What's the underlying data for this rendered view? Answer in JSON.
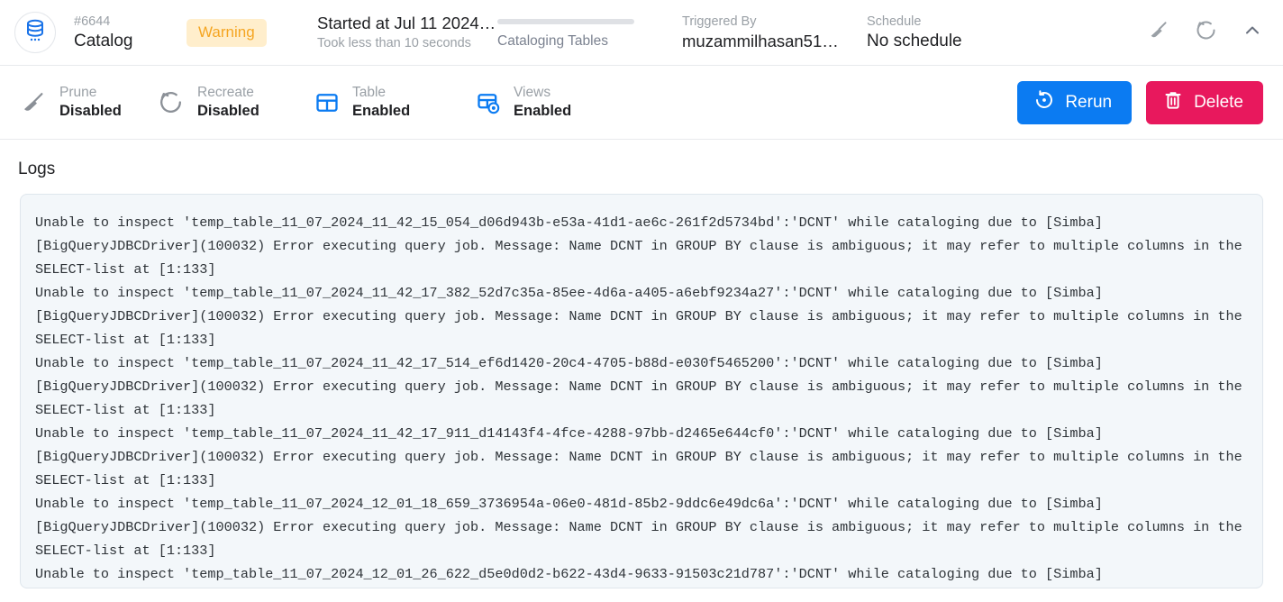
{
  "header": {
    "avatar_icon": "database-icon",
    "run_number_label": "#6644",
    "run_name": "Catalog",
    "status_badge": "Warning",
    "status_badge_color": "#f5a623",
    "started_title": "Started at Jul 11 2024, …",
    "started_subtitle": "Took less than 10 seconds",
    "progress_label": "Cataloging Tables",
    "triggered_by_label": "Triggered By",
    "triggered_by_value": "muzammilhasan515…",
    "schedule_label": "Schedule",
    "schedule_value": "No schedule",
    "icons": [
      "broom-icon",
      "recreate-icon",
      "chevron-up-icon"
    ]
  },
  "actionbar": {
    "items": [
      {
        "icon": "broom-icon",
        "name": "Prune",
        "value": "Disabled",
        "enabled": false
      },
      {
        "icon": "recreate-icon",
        "name": "Recreate",
        "value": "Disabled",
        "enabled": false
      },
      {
        "icon": "table-icon",
        "name": "Table",
        "value": "Enabled",
        "enabled": true
      },
      {
        "icon": "views-icon",
        "name": "Views",
        "value": "Enabled",
        "enabled": true
      }
    ],
    "rerun_label": "Rerun",
    "rerun_icon": "rerun-icon",
    "rerun_color": "#0b7bf2",
    "delete_label": "Delete",
    "delete_icon": "trash-icon",
    "delete_color": "#e8185d"
  },
  "logs": {
    "title": "Logs",
    "content": "Unable to inspect 'temp_table_11_07_2024_11_42_15_054_d06d943b-e53a-41d1-ae6c-261f2d5734bd':'DCNT' while cataloging due to [Simba][BigQueryJDBCDriver](100032) Error executing query job. Message: Name DCNT in GROUP BY clause is ambiguous; it may refer to multiple columns in the SELECT-list at [1:133]\nUnable to inspect 'temp_table_11_07_2024_11_42_17_382_52d7c35a-85ee-4d6a-a405-a6ebf9234a27':'DCNT' while cataloging due to [Simba][BigQueryJDBCDriver](100032) Error executing query job. Message: Name DCNT in GROUP BY clause is ambiguous; it may refer to multiple columns in the SELECT-list at [1:133]\nUnable to inspect 'temp_table_11_07_2024_11_42_17_514_ef6d1420-20c4-4705-b88d-e030f5465200':'DCNT' while cataloging due to [Simba][BigQueryJDBCDriver](100032) Error executing query job. Message: Name DCNT in GROUP BY clause is ambiguous; it may refer to multiple columns in the SELECT-list at [1:133]\nUnable to inspect 'temp_table_11_07_2024_11_42_17_911_d14143f4-4fce-4288-97bb-d2465e644cf0':'DCNT' while cataloging due to [Simba][BigQueryJDBCDriver](100032) Error executing query job. Message: Name DCNT in GROUP BY clause is ambiguous; it may refer to multiple columns in the SELECT-list at [1:133]\nUnable to inspect 'temp_table_11_07_2024_12_01_18_659_3736954a-06e0-481d-85b2-9ddc6e49dc6a':'DCNT' while cataloging due to [Simba][BigQueryJDBCDriver](100032) Error executing query job. Message: Name DCNT in GROUP BY clause is ambiguous; it may refer to multiple columns in the SELECT-list at [1:133]\nUnable to inspect 'temp_table_11_07_2024_12_01_26_622_d5e0d0d2-b622-43d4-9633-91503c21d787':'DCNT' while cataloging due to [Simba]"
  }
}
